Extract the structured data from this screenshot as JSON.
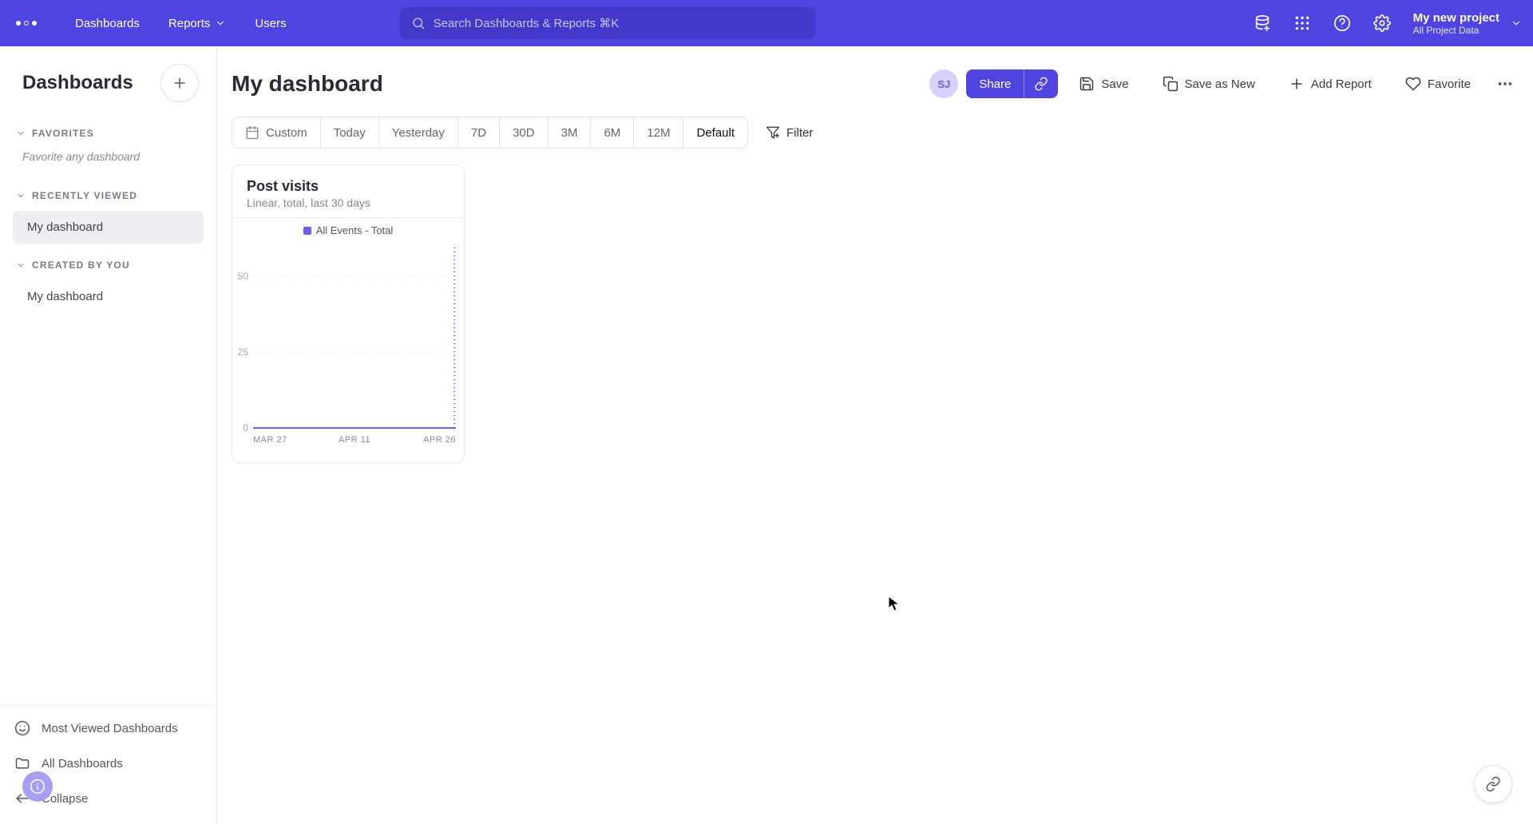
{
  "topnav": {
    "dashboards": "Dashboards",
    "reports": "Reports",
    "users": "Users",
    "search_placeholder": "Search Dashboards & Reports ⌘K",
    "project_name": "My new project",
    "project_sub": "All Project Data"
  },
  "sidebar": {
    "title": "Dashboards",
    "favorites_label": "FAVORITES",
    "favorites_hint": "Favorite any dashboard",
    "recent_label": "RECENTLY VIEWED",
    "recent_item": "My dashboard",
    "created_label": "CREATED BY YOU",
    "created_item": "My dashboard",
    "most_viewed": "Most Viewed Dashboards",
    "all_dashboards": "All Dashboards",
    "collapse": "Collapse"
  },
  "main": {
    "title": "My dashboard",
    "avatar": "SJ",
    "share": "Share",
    "save": "Save",
    "save_as_new": "Save as New",
    "add_report": "Add Report",
    "favorite": "Favorite",
    "range": {
      "custom": "Custom",
      "today": "Today",
      "yesterday": "Yesterday",
      "d7": "7D",
      "d30": "30D",
      "m3": "3M",
      "m6": "6M",
      "m12": "12M",
      "default": "Default"
    },
    "filter": "Filter"
  },
  "card": {
    "title": "Post visits",
    "subtitle": "Linear, total, last 30 days",
    "legend": "All Events - Total"
  },
  "chart_data": {
    "type": "line",
    "title": "Post visits",
    "ylabel": "",
    "xlabel": "",
    "ylim": [
      0,
      60
    ],
    "yticks": [
      0,
      25,
      50
    ],
    "categories": [
      "MAR 27",
      "APR 11",
      "APR 26"
    ],
    "series": [
      {
        "name": "All Events - Total",
        "color": "#6e5ef2",
        "values": [
          0,
          0,
          0,
          0,
          0,
          0,
          0,
          0,
          0,
          0,
          0,
          0,
          0,
          0,
          0,
          0,
          0,
          0,
          0,
          0,
          0,
          0,
          0,
          0,
          0,
          0,
          0,
          0,
          0,
          0
        ]
      }
    ]
  },
  "colors": {
    "primary": "#4f44e0",
    "accent": "#6e5ef2"
  }
}
